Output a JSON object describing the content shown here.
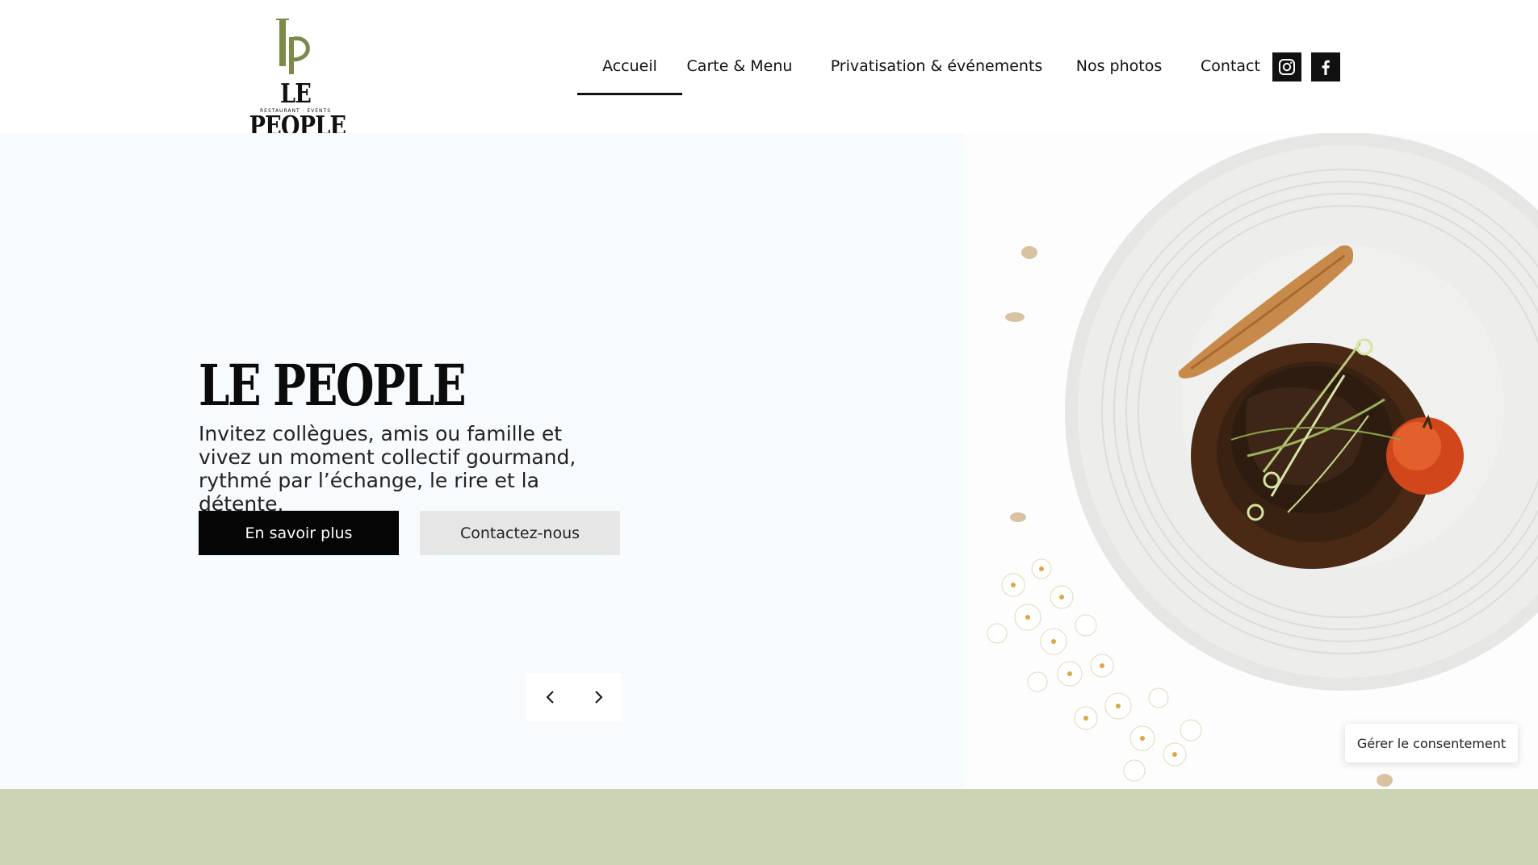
{
  "brand": {
    "logo_monogram": "lp",
    "logo_wordmark": "LE PEOPLE",
    "logo_tagline": "RESTAURANT · EVENTS",
    "accent_color": "#7b8a4a",
    "band_color": "#ccd4b5"
  },
  "nav": {
    "items": [
      {
        "label": "Accueil",
        "active": true
      },
      {
        "label": "Carte & Menu",
        "active": false
      },
      {
        "label": "Privatisation & événements",
        "active": false
      },
      {
        "label": "Nos photos",
        "active": false
      },
      {
        "label": "Contact",
        "active": false
      }
    ],
    "social": [
      {
        "icon": "instagram-icon"
      },
      {
        "icon": "facebook-icon"
      }
    ]
  },
  "hero": {
    "title": "LE PEOPLE",
    "text": "Invitez collègues, amis ou famille et vivez un moment collectif gourmand, rythmé par l’échange, le rire et la détente.",
    "primary_button": "En savoir plus",
    "secondary_button": "Contactez-nous",
    "image": "plate-of-braised-beef-with-flowers"
  },
  "consent": {
    "label": "Gérer le consentement"
  }
}
